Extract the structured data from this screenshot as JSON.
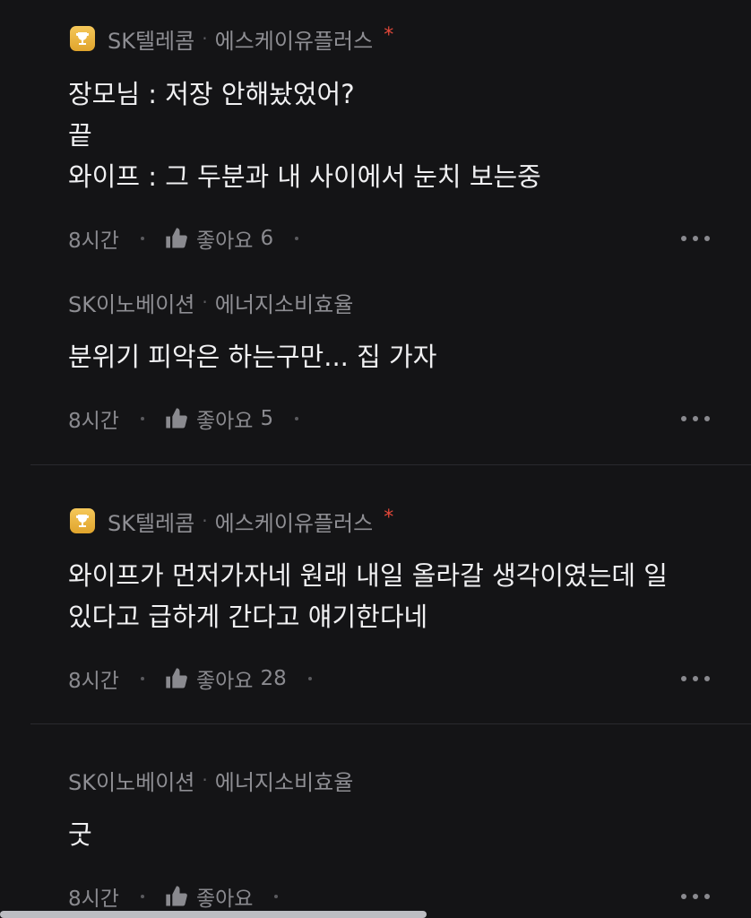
{
  "comments": [
    {
      "author": "SK텔레콤",
      "dept": "에스케이유플러스",
      "has_badge": true,
      "star": "*",
      "lines": [
        "장모님 : 저장 안해놨었어?",
        "끝",
        "와이프 : 그 두분과 내 사이에서 눈치 보는중"
      ],
      "time": "8시간",
      "like_label": "좋아요",
      "like_count": "6"
    },
    {
      "author": "SK이노베이션",
      "dept": "에너지소비효율",
      "has_badge": false,
      "lines": [
        "분위기 피악은 하는구만... 집 가자"
      ],
      "time": "8시간",
      "like_label": "좋아요",
      "like_count": "5"
    },
    {
      "author": "SK텔레콤",
      "dept": "에스케이유플러스",
      "has_badge": true,
      "star": "*",
      "lines": [
        "와이프가 먼저가자네 원래 내일 올라갈 생각이였는데 일",
        "있다고 급하게 간다고 얘기한다네"
      ],
      "time": "8시간",
      "like_label": "좋아요",
      "like_count": "28"
    },
    {
      "author": "SK이노베이션",
      "dept": "에너지소비효율",
      "has_badge": false,
      "lines": [
        "굿"
      ],
      "time": "8시간",
      "like_label": "좋아요",
      "like_count": ""
    }
  ],
  "meta_separator": "·",
  "icons": {
    "badge": "trophy-icon",
    "like": "thumbs-up-icon",
    "more": "more-horizontal-icon"
  },
  "colors": {
    "background": "#141416",
    "text": "#f0f0f2",
    "muted": "#8a8a8f",
    "star": "#e5483a",
    "badge": "#e8b23c"
  }
}
